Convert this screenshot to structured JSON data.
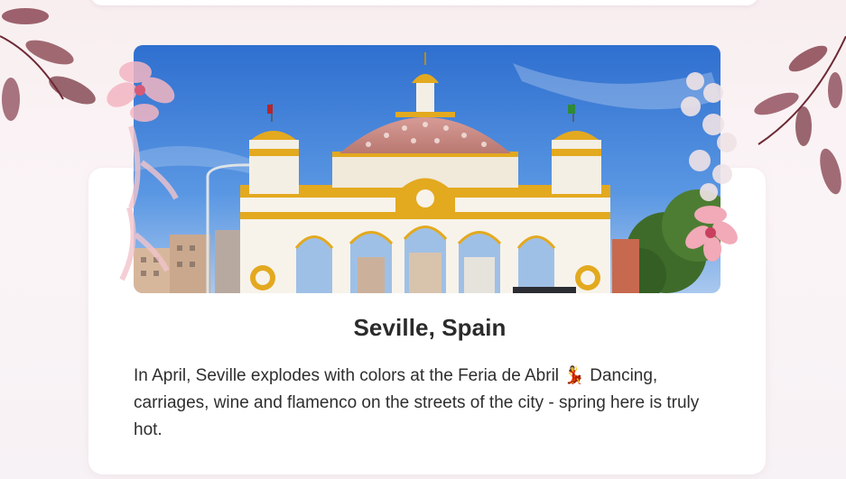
{
  "card": {
    "title": "Seville, Spain",
    "description": "In April, Seville explodes with colors at the Feria de Abril 💃 Dancing, carriages, wine and flamenco on the streets of the city - spring here is truly hot."
  },
  "colors": {
    "sky": "#3f7fd6",
    "gold": "#e3a91f",
    "dome": "#c98a85",
    "leaf": "#7a2f3b",
    "blossom": "#f2a9b8"
  }
}
